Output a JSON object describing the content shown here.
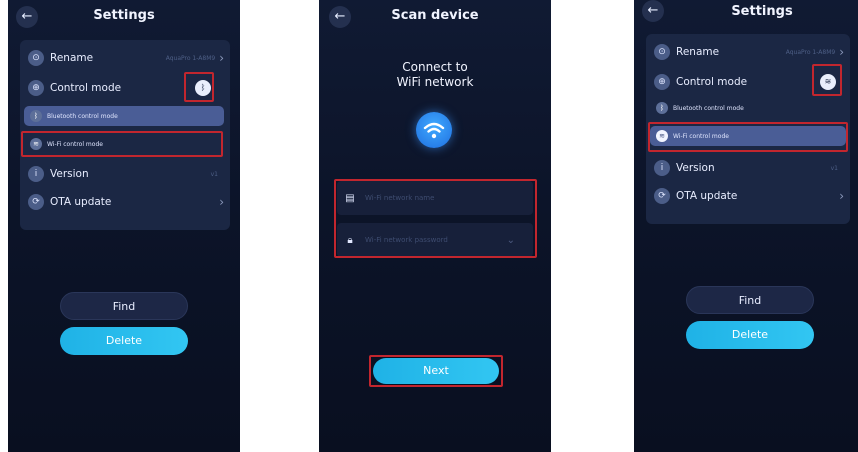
{
  "settings": {
    "title": "Settings",
    "back_icon": "←",
    "rename_label": "Rename",
    "rename_value": "AquaPro 1-A8M9",
    "control_mode_label": "Control mode",
    "bluetooth_mode_label": "Bluetooth control mode",
    "wifi_mode_label": "Wi-Fi control mode",
    "version_label": "Version",
    "version_value": "v1",
    "ota_label": "OTA update",
    "find_label": "Find",
    "delete_label": "Delete"
  },
  "scan": {
    "title": "Scan device",
    "back_icon": "←",
    "heading_line1": "Connect to",
    "heading_line2": "WiFi network",
    "network_name_placeholder": "Wi-Fi network name",
    "network_password_placeholder": "Wi-Fi network password",
    "next_label": "Next"
  },
  "colors": {
    "highlight_box": "#c2262e",
    "accent_cyan": "#32c6f2",
    "background": "#0c1429"
  },
  "icons": {
    "back": "arrow-left-icon",
    "wifi": "wifi-icon",
    "bluetooth": "bluetooth-icon",
    "router": "router-icon",
    "lock": "lock-icon",
    "chevron": "chevron-right-icon"
  }
}
